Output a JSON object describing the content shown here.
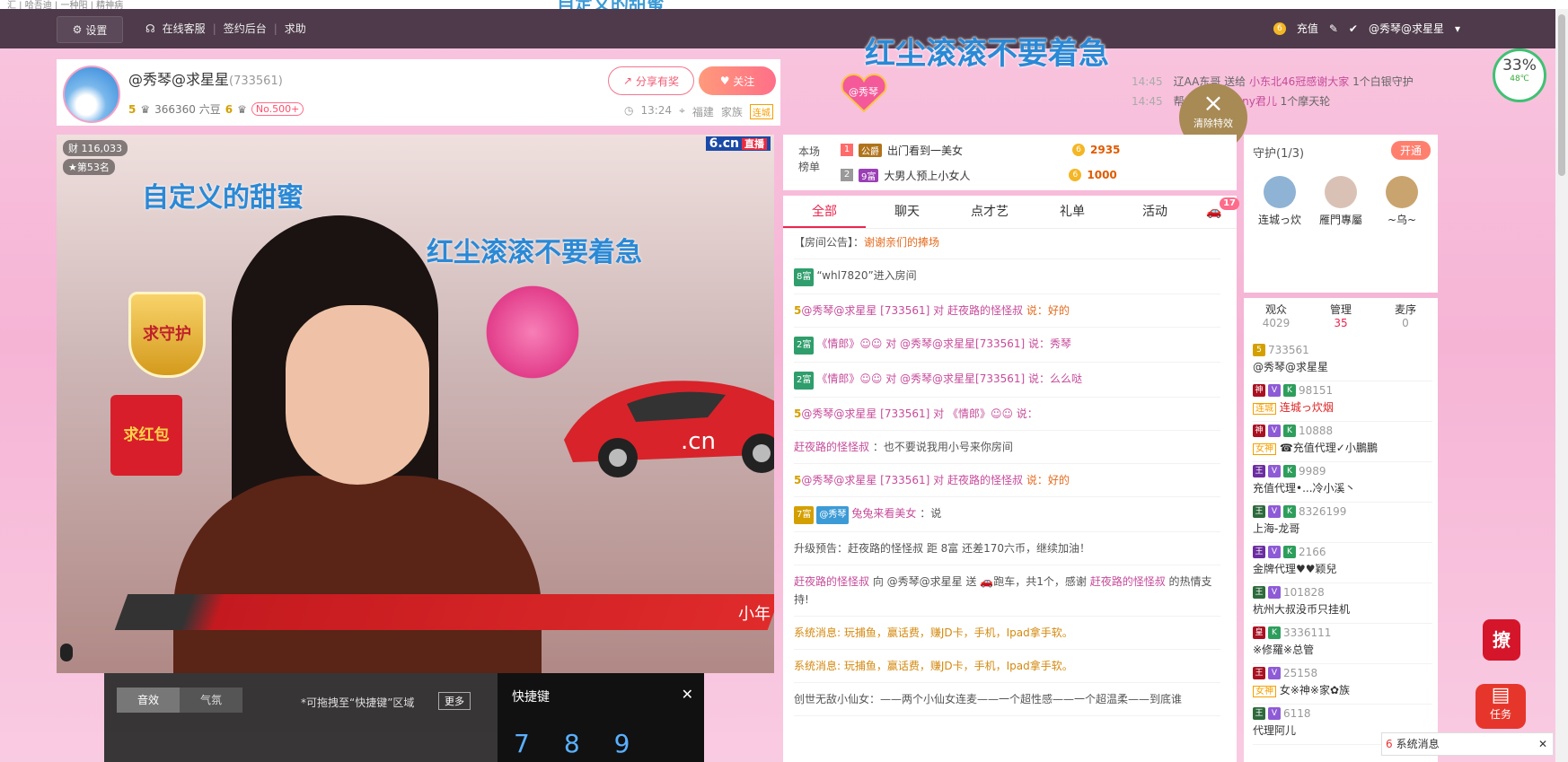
{
  "browser": {
    "tab_fragment": "汇 | 哈吾迪 | 一种阳 | 精神病",
    "overlay_top": "自定义的甜蜜"
  },
  "topbar": {
    "settings": "设置",
    "links": [
      "在线客服",
      "签约后台",
      "求助"
    ],
    "recharge": "充值",
    "user": "@秀琴@求星星"
  },
  "system": {
    "percent": "33%",
    "temp": "48℃"
  },
  "anchor": {
    "name": "@秀琴@求星星",
    "room_id": "(733561)",
    "level": "5",
    "beans": "366360 六豆",
    "level2": "6",
    "no": "No.500+",
    "share": "分享有奖",
    "follow": "关注",
    "time": "13:24",
    "location": "福建",
    "family": "家族",
    "family_tag": "连城"
  },
  "overlay": {
    "headline": "红尘滚滚不要着急",
    "heart_badge": "@秀琴",
    "clear_fx": "清除特效"
  },
  "ticker": [
    {
      "time": "14:45",
      "text_a": "辽AA东哥 送给 ",
      "name": "小东北46冠感谢大家",
      "text_b": " 1个白银守护"
    },
    {
      "time": "14:45",
      "text_a": "帮 送给 ",
      "name": "✷Sunny君儿",
      "text_b": " 1个摩天轮"
    }
  ],
  "video": {
    "fans": "116,033",
    "rank": "第53名",
    "logo": "6.cn",
    "logo_tag": "直播",
    "text1": "自定义的甜蜜",
    "text2": "红尘滚滚不要着急",
    "shield": "求守护",
    "envelope": "求红包",
    "caption": "小年"
  },
  "bottom": {
    "tabs": [
      "音效",
      "气氛"
    ],
    "hint": "*可拖拽至“快捷键”区域",
    "more": "更多",
    "shortcut_title": "快捷键",
    "nums": "789"
  },
  "gift_rank": {
    "label": "本场榜单",
    "rows": [
      {
        "n": "1",
        "tag": "公爵",
        "name": "出门看到一美女",
        "value": "2935"
      },
      {
        "n": "2",
        "tag": "9富",
        "name": "大男人预上小女人",
        "value": "1000"
      }
    ]
  },
  "chat": {
    "tabs": [
      "全部",
      "聊天",
      "点才艺",
      "礼单",
      "活动"
    ],
    "car_count": "17",
    "notice_label": "【房间公告】：",
    "notice": "谢谢亲们的捧场",
    "messages": [
      {
        "a": "8富",
        "b": "“whl7820”进入房间"
      },
      {
        "a": "5",
        "b": "@秀琴@求星星 [733561] 对 ",
        "c": "赶夜路的怪怪叔",
        "d": " 说：好的"
      },
      {
        "a": "2富",
        "b": "《情郎》☺☺ 对 @秀琴@求星星[733561] 说：秀琴"
      },
      {
        "a": "2富",
        "b": "《情郎》☺☺ 对 @秀琴@求星星[733561] 说：么么哒"
      },
      {
        "a": "5",
        "b": "@秀琴@求星星 [733561] 对 《情郎》☺☺ 说："
      },
      {
        "a": "",
        "b": "赶夜路的怪怪叔",
        "c": " ：也不要说我用小号来你房间"
      },
      {
        "a": "5",
        "b": "@秀琴@求星星 [733561] 对 ",
        "c": "赶夜路的怪怪叔",
        "d": " 说：好的"
      },
      {
        "a": "7富",
        "b": "@秀琴",
        "c": "兔兔来看美女",
        "d": " ：说"
      }
    ],
    "upgrade": "升级预告：赶夜路的怪怪叔 距 8富 还差170六币，继续加油！",
    "gift_msg_a": "赶夜路的怪怪叔",
    "gift_msg_b": " 向 @秀琴@求星星 送 ",
    "gift_msg_c": "跑车，共1个，感谢 ",
    "gift_msg_d": "赶夜路的怪怪叔",
    "gift_msg_e": " 的热情支持!",
    "sys1": "系统消息: 玩捕鱼，赢话费，赚JD卡，手机，Ipad拿手软。",
    "sys2": "系统消息: 玩捕鱼，赢话费，赚JD卡，手机，Ipad拿手软。",
    "last": "创世无敌小仙女：——两个小仙女连麦——一个超性感——一个超温柔——到底谁"
  },
  "guard": {
    "title": "守护",
    "count": "(1/3)",
    "open": "开通",
    "members": [
      "连城っ炊",
      "雁門專屬",
      "~乌~"
    ]
  },
  "audience": {
    "tabs": [
      {
        "label": "观众",
        "count": "4029"
      },
      {
        "label": "管理",
        "count": "35"
      },
      {
        "label": "麦序",
        "count": "0"
      }
    ],
    "rows": [
      {
        "num": "733561",
        "name": "@秀琴@求星星",
        "tag": ""
      },
      {
        "num": "98151",
        "name": "连城っ炊烟",
        "tag": "连城"
      },
      {
        "num": "10888",
        "name": "☎充值代理✓小鵬鵬",
        "tag": "女神"
      },
      {
        "num": "9989",
        "name": "充值代理•...冷小溪丶",
        "tag": ""
      },
      {
        "num": "8326199",
        "name": "上海-龙哥",
        "tag": ""
      },
      {
        "num": "2166",
        "name": "金牌代理♥♥颖兒",
        "tag": ""
      },
      {
        "num": "101828",
        "name": "杭州大叔没币只挂机",
        "tag": ""
      },
      {
        "num": "3336111",
        "name": "※修羅※总管",
        "tag": ""
      },
      {
        "num": "25158",
        "name": "女※神※家✿族",
        "tag": "女神"
      },
      {
        "num": "6118",
        "name": "代理阿儿",
        "tag": ""
      }
    ]
  },
  "float": {
    "liao": "撩",
    "task": "任务",
    "sysmsg": "系统消息"
  }
}
